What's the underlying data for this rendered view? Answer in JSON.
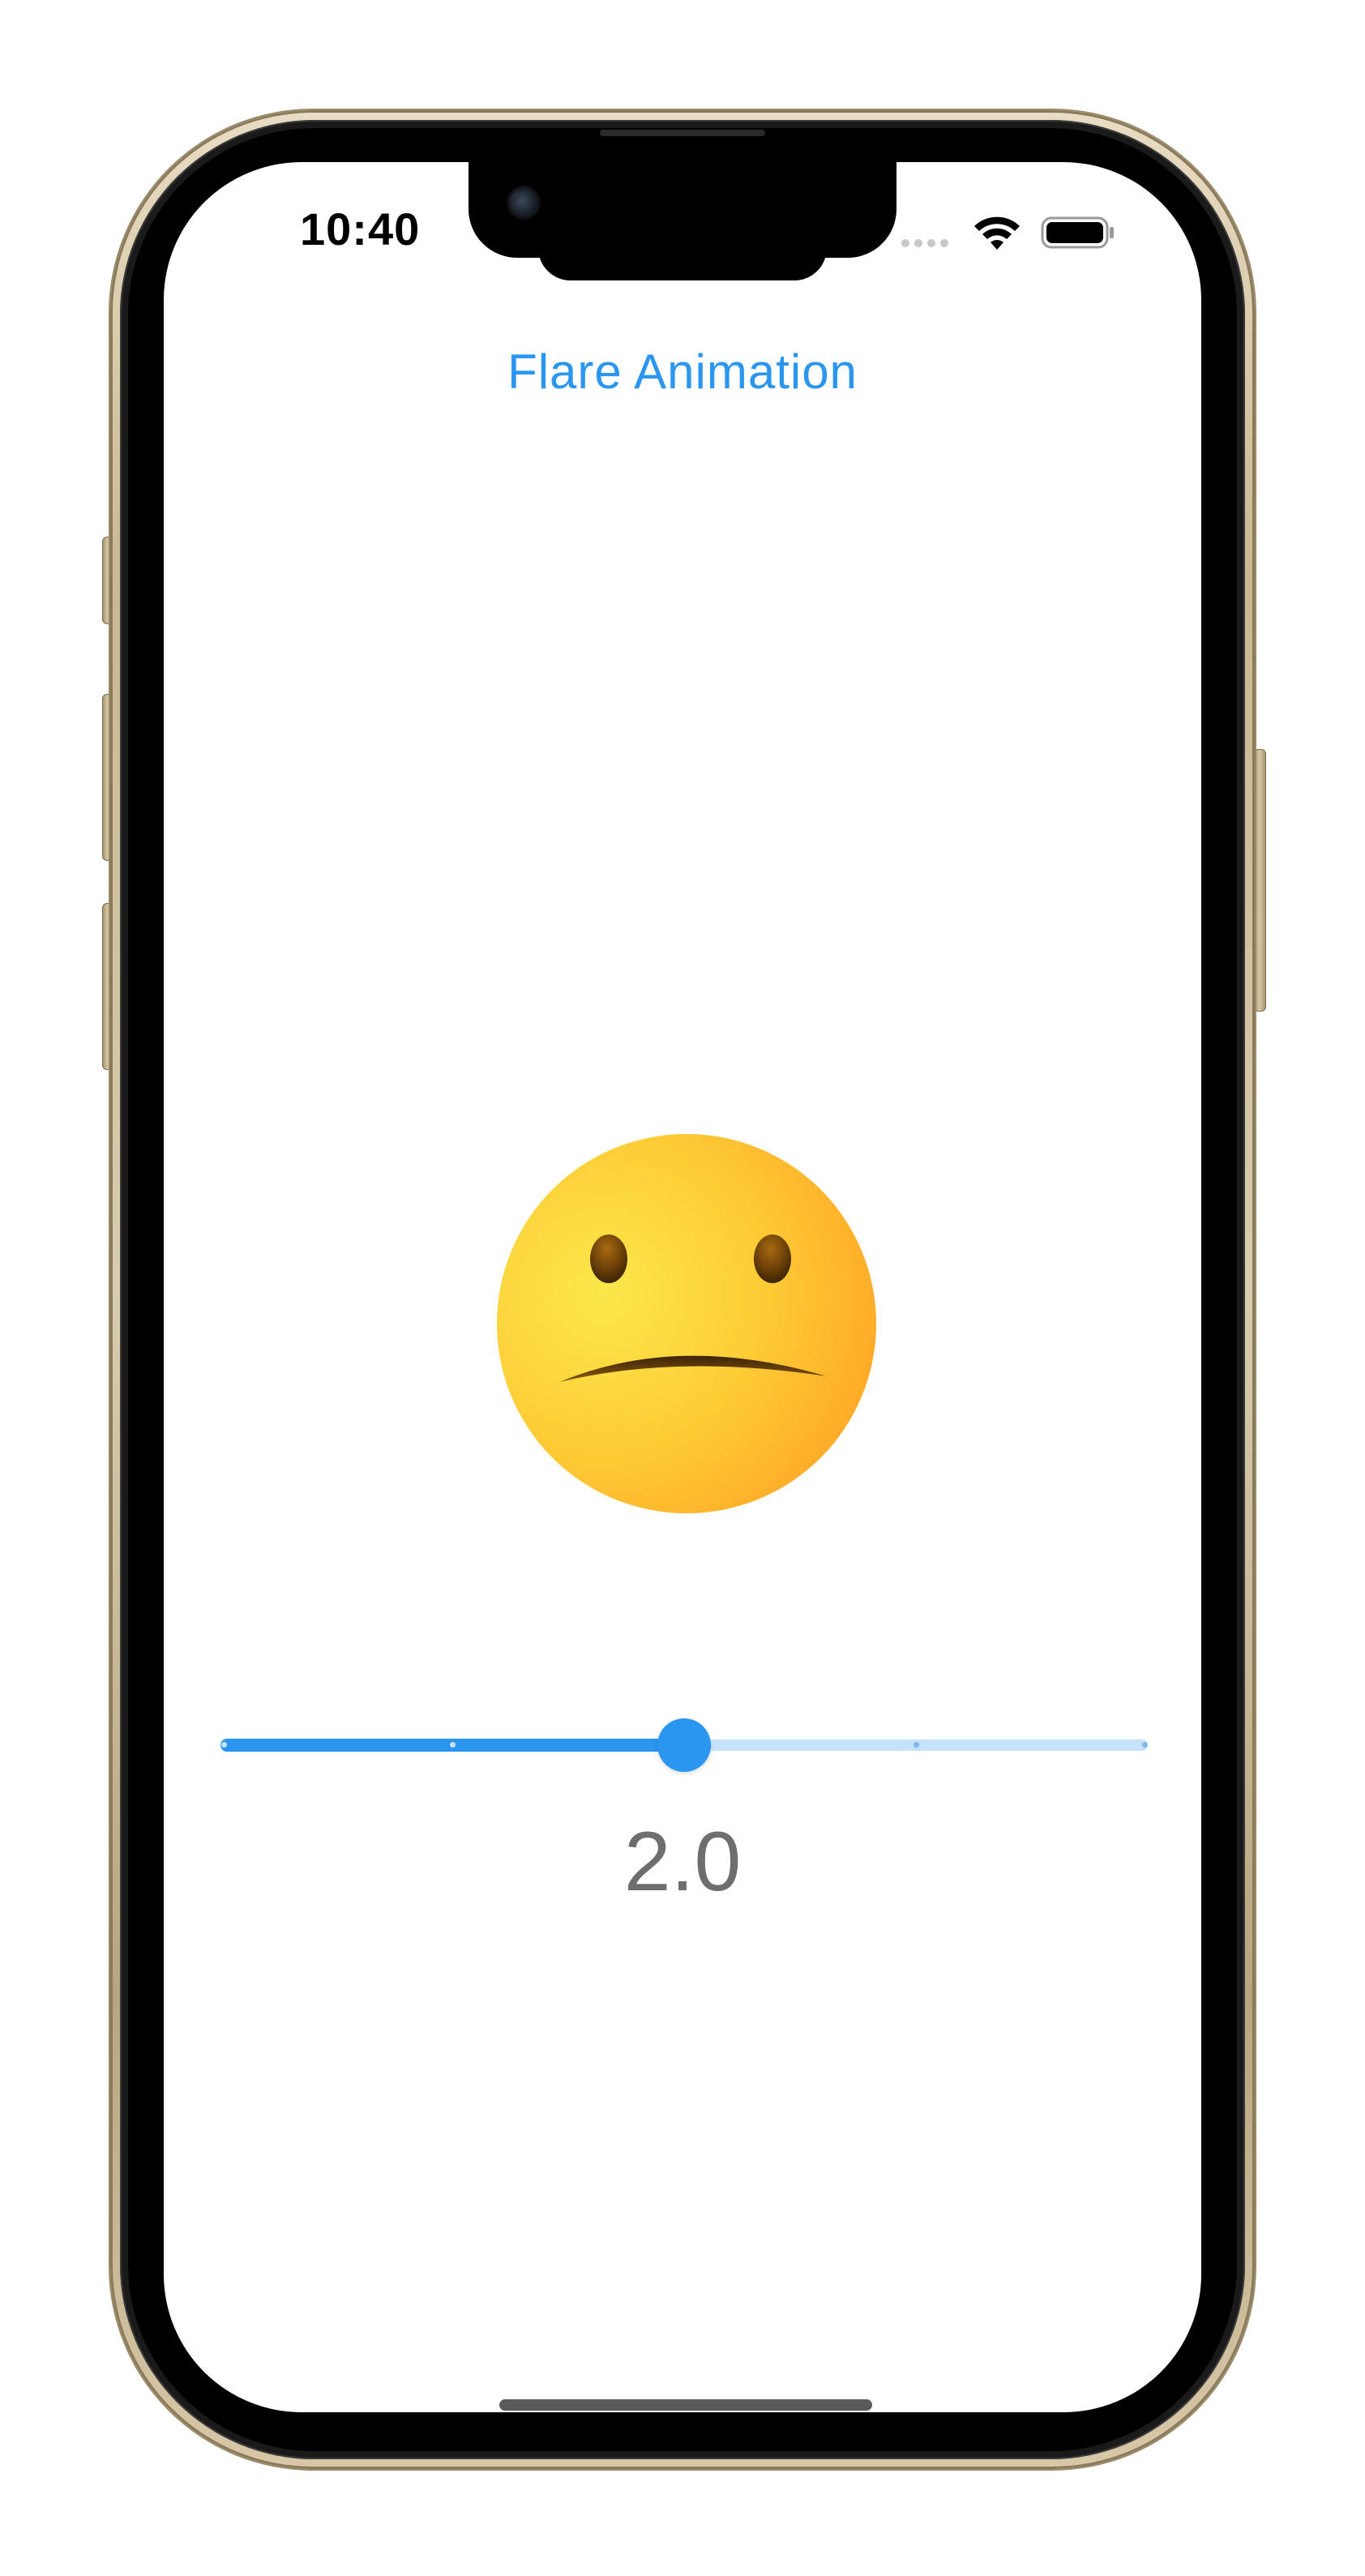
{
  "status_bar": {
    "time": "10:40",
    "icons": [
      "cellular-signal-icon",
      "wifi-icon",
      "battery-icon"
    ]
  },
  "app": {
    "title": "Flare Animation",
    "face_icon": "neutral-face-icon",
    "slider": {
      "value": 2.0,
      "min": 0,
      "max": 4,
      "divisions": 4,
      "value_label": "2.0"
    }
  },
  "colors": {
    "accent": "#2a96f0",
    "track_inactive": "#c6e2fa",
    "value_text": "#6e6e6e",
    "face_yellow": "#fdd835",
    "face_orange": "#ffa726"
  }
}
